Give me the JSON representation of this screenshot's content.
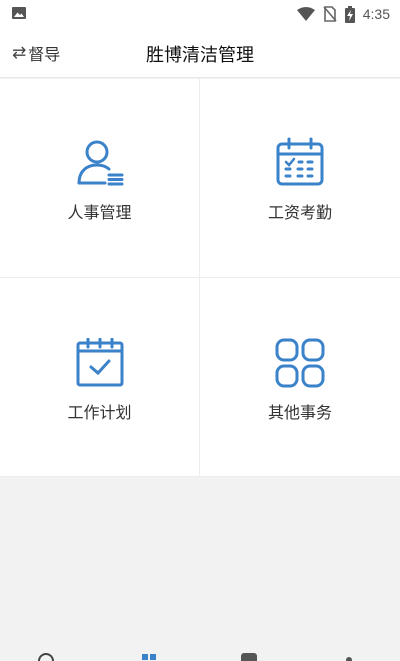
{
  "status_bar": {
    "time": "4:35",
    "icons": [
      "image-icon",
      "wifi-icon",
      "no-sim-icon",
      "battery-charging-icon"
    ]
  },
  "header": {
    "switch_label": "督导",
    "switch_icon": "swap-icon",
    "title": "胜博清洁管理"
  },
  "grid": {
    "items": [
      {
        "label": "人事管理",
        "icon": "user-list-icon"
      },
      {
        "label": "工资考勤",
        "icon": "calendar-grid-icon"
      },
      {
        "label": "工作计划",
        "icon": "calendar-check-icon"
      },
      {
        "label": "其他事务",
        "icon": "apps-grid-icon"
      }
    ]
  },
  "colors": {
    "accent": "#3a82c9",
    "text": "#333333",
    "background": "#f2f2f2"
  }
}
